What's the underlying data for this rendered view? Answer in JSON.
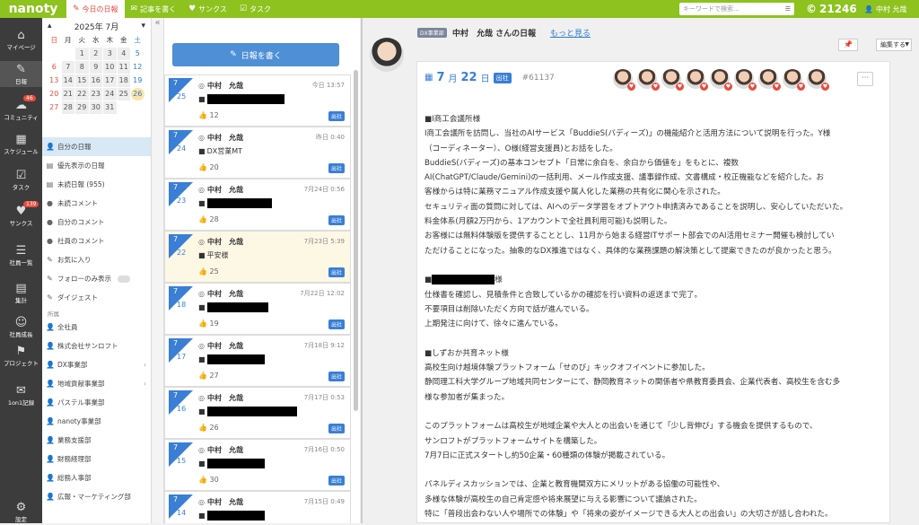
{
  "topbar": {
    "logo": "nanoty",
    "nav": [
      {
        "icon": "diary-icon",
        "glyph": "✎",
        "label": "今日の日報",
        "active": true
      },
      {
        "icon": "speech-icon",
        "glyph": "✉",
        "label": "記事を書く",
        "active": false
      },
      {
        "icon": "heart-icon",
        "glyph": "♥",
        "label": "サンクス",
        "active": false
      },
      {
        "icon": "task-icon",
        "glyph": "☑",
        "label": "タスク",
        "active": false
      }
    ],
    "search_placeholder": "キーワードで検索…",
    "points": "21246",
    "user": "中村 允哉"
  },
  "leftnav": [
    {
      "label": "マイページ",
      "glyph": "⌂",
      "icon": "home-icon",
      "badge": ""
    },
    {
      "label": "日報",
      "glyph": "✎",
      "icon": "diary-icon",
      "badge": "",
      "active": true
    },
    {
      "label": "コミュニティ",
      "glyph": "☁",
      "icon": "community-icon",
      "badge": "46"
    },
    {
      "label": "スケジュール",
      "glyph": "▦",
      "icon": "calendar-icon",
      "badge": ""
    },
    {
      "label": "タスク",
      "glyph": "☑",
      "icon": "task-icon",
      "badge": ""
    },
    {
      "label": "サンクス",
      "glyph": "♥",
      "icon": "heart-icon",
      "badge": "139"
    },
    {
      "label": "社員一覧",
      "glyph": "☰",
      "icon": "employees-icon",
      "badge": ""
    },
    {
      "label": "集計",
      "glyph": "▤",
      "icon": "aggregate-icon",
      "badge": ""
    },
    {
      "label": "社員成長",
      "glyph": "☺",
      "icon": "growth-icon",
      "badge": ""
    },
    {
      "label": "プロジェクト",
      "glyph": "⚑",
      "icon": "project-icon",
      "badge": ""
    },
    {
      "label": "1on1記録",
      "glyph": "✉",
      "icon": "oneonone-icon",
      "badge": ""
    },
    {
      "label": "設定",
      "glyph": "⚙",
      "icon": "gear-icon",
      "badge": ""
    }
  ],
  "calendar": {
    "title": "2025年 7月",
    "weekdays": [
      "日",
      "月",
      "火",
      "水",
      "木",
      "金",
      "土"
    ],
    "cells": [
      "",
      "",
      "1",
      "2",
      "3",
      "4",
      "5",
      "6",
      "7",
      "8",
      "9",
      "10",
      "11",
      "12",
      "13",
      "14",
      "15",
      "16",
      "17",
      "18",
      "19",
      "20",
      "21",
      "22",
      "23",
      "24",
      "25",
      "26",
      "27",
      "28",
      "29",
      "30",
      "31",
      "",
      ""
    ],
    "today": "26"
  },
  "sidebar_menu": [
    {
      "label": "自分の日報",
      "icon": "person-icon",
      "glyph": "👤",
      "active": true
    },
    {
      "label": "優先表示の日報",
      "icon": "doc-icon",
      "glyph": "▤"
    },
    {
      "label": "未読日報 (955)",
      "icon": "doc-icon",
      "glyph": "▤"
    },
    {
      "label": "未読コメント",
      "icon": "comment-icon",
      "glyph": "●"
    },
    {
      "label": "自分のコメント",
      "icon": "comment-icon",
      "glyph": "●"
    },
    {
      "label": "社員のコメント",
      "icon": "comment-icon",
      "glyph": "●"
    },
    {
      "label": "お気に入り",
      "icon": "star-icon",
      "glyph": "✎"
    },
    {
      "label": "フォローのみ表示",
      "icon": "follow-icon",
      "glyph": "✎",
      "toggle": true
    },
    {
      "label": "ダイジェスト",
      "icon": "digest-icon",
      "glyph": "✎"
    }
  ],
  "section_label": "所属",
  "groups": [
    {
      "label": "全社員",
      "arrow": false
    },
    {
      "label": "株式会社サンロフト",
      "arrow": false
    },
    {
      "label": "DX事業部",
      "arrow": true
    },
    {
      "label": "地域貢献事業部",
      "arrow": true
    },
    {
      "label": "パステル事業部",
      "arrow": false
    },
    {
      "label": "nanoty事業部",
      "arrow": false
    },
    {
      "label": "業務支援部",
      "arrow": false
    },
    {
      "label": "財務経理部",
      "arrow": false
    },
    {
      "label": "総務人事部",
      "arrow": false
    },
    {
      "label": "広報・マーケティング部",
      "arrow": false
    }
  ],
  "write_button": "日報を書く",
  "collapse_glyph": "«",
  "reports": [
    {
      "month": "7",
      "day": "25",
      "name": "中村　允哉",
      "time": "今日 13:57",
      "sub": "",
      "redact": 86,
      "likes": "12",
      "tag": "出社",
      "highlight": false
    },
    {
      "month": "7",
      "day": "24",
      "name": "中村　允哉",
      "time": "昨日 0:40",
      "sub": "DX営業MT",
      "redact": 0,
      "likes": "20",
      "tag": "出社",
      "highlight": false
    },
    {
      "month": "7",
      "day": "23",
      "name": "中村　允哉",
      "time": "7月24日 0:56",
      "sub": "",
      "redact": 72,
      "likes": "28",
      "tag": "出社",
      "highlight": false
    },
    {
      "month": "7",
      "day": "22",
      "name": "中村　允哉",
      "time": "7月23日 5:39",
      "sub": "平安様",
      "redact": 0,
      "likes": "25",
      "tag": "出社",
      "highlight": true
    },
    {
      "month": "7",
      "day": "18",
      "name": "中村　允哉",
      "time": "7月22日 12:02",
      "sub": "",
      "redact": 68,
      "likes": "19",
      "tag": "出社",
      "highlight": false
    },
    {
      "month": "7",
      "day": "17",
      "name": "中村　允哉",
      "time": "7月18日 9:12",
      "sub": "",
      "redact": 64,
      "likes": "27",
      "tag": "出社",
      "highlight": false
    },
    {
      "month": "7",
      "day": "16",
      "name": "中村　允哉",
      "time": "7月17日 0:53",
      "sub": "",
      "redact": 100,
      "likes": "26",
      "tag": "出社",
      "highlight": false
    },
    {
      "month": "7",
      "day": "15",
      "name": "中村　允哉",
      "time": "7月16日 0:50",
      "sub": "",
      "redact": 64,
      "likes": "30",
      "tag": "出社",
      "highlight": false
    },
    {
      "month": "7",
      "day": "14",
      "name": "中村　允哉",
      "time": "7月15日 0:49",
      "sub": "",
      "redact": 64,
      "likes": "26",
      "tag": "出社",
      "highlight": false
    }
  ],
  "main": {
    "dept_tag": "DX事業部",
    "title": "中村　允哉 さんの日報",
    "more": "もっと見る",
    "pin": "📌",
    "edit": "編集する",
    "month": "7",
    "month_label": "月",
    "day": "22",
    "day_label": "日",
    "tag": "出社",
    "id": "#61137",
    "reactor_count": 9,
    "more_menu": "···",
    "lines": [
      "■I商工会議所様",
      "I商工会議所を訪問し、当社のAIサービス「BuddieS(バディーズ)」の機能紹介と活用方法について説明を行った。Y様",
      "（コーディネーター）、O様(経営支援員)とお話をした。",
      "BuddieS(バディーズ)の基本コンセプト「日常に余白を、余白から価値を」をもとに、複数",
      "AI(ChatGPT/Claude/Gemini)の一括利用、メール作成支援、議事録作成、文書構成・校正機能などを紹介した。お",
      "客様からは特に業務マニュアル作成支援や属人化した業務の共有化に関心を示された。",
      "セキュリティ面の質問に対しては、AIへのデータ学習をオプトアウト申請済みであることを説明し、安心していただいた。",
      "料金体系(月額2万円から、1アカウントで全社員利用可能)も説明した。",
      "お客様には無料体験版を提供することとし、11月から始まる経営ITサポート部会でのAI活用セミナー開催も検討してい",
      "ただけることになった。抽象的なDX推進ではなく、具体的な業務課題の解決策として提案できたのが良かったと思う。",
      "",
      "■[REDACTED]様",
      "仕様書を確認し、見積条件と合致しているかの確認を行い資料の返送まで完了。",
      "不要項目は削除いただく方向で話が進んでいる。",
      "上期発注に向けて、徐々に進んでいる。",
      "",
      "■しずおか共育ネット様",
      "高校生向け越境体験プラットフォーム「せのび」キックオフイベントに参加した。",
      "静岡理工科大学グループ地域共同センターにて、静岡教育ネットの関係者や県教育委員会、企業代表者、高校生を含む多",
      "様な参加者が集まった。",
      "",
      "このプラットフォームは高校生が地域企業や大人との出会いを通じて「少し背伸び」する機会を提供するもので、",
      "サンロフトがプラットフォームサイトを構築した。",
      "7月7日に正式スタートし約50企業・60種類の体験が掲載されている。",
      "",
      "パネルディスカッションでは、企業と教育機関双方にメリットがある協働の可能性や、",
      "多様な体験が高校生の自己肯定感や将来展望に与える影響について議論された。",
      "特に「普段出会わない人や場所での体験」や「将来の姿がイメージできる大人との出会い」の大切さが話し合われた。"
    ]
  }
}
